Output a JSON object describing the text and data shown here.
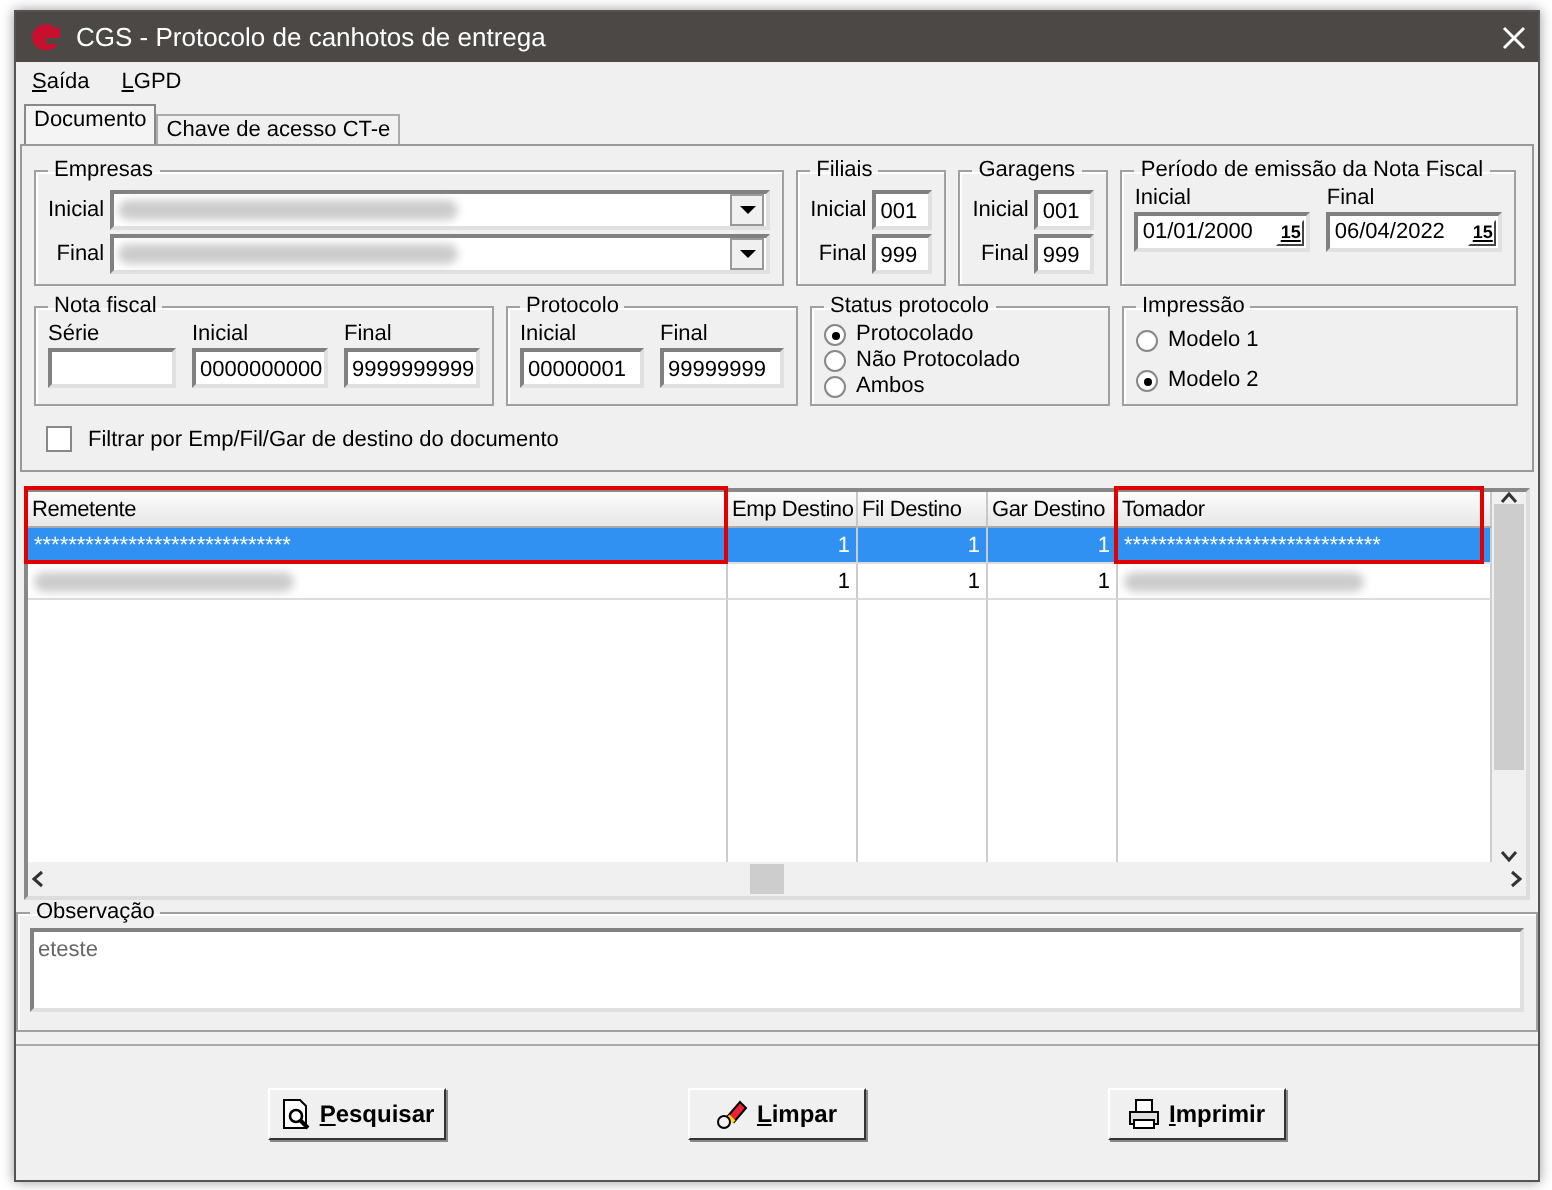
{
  "window": {
    "title": "CGS - Protocolo de canhotos de entrega"
  },
  "menu": [
    {
      "label": "Saída"
    },
    {
      "label": "LGPD"
    }
  ],
  "tabs": [
    {
      "label": "Documento",
      "selected": true
    },
    {
      "label": "Chave de acesso CT-e",
      "selected": false
    }
  ],
  "empresas": {
    "title": "Empresas",
    "fields": [
      {
        "label": "Inicial"
      },
      {
        "label": "Final"
      }
    ]
  },
  "filiais": {
    "title": "Filiais",
    "fields": [
      {
        "label": "Inicial",
        "value": "001"
      },
      {
        "label": "Final",
        "value": "999"
      }
    ]
  },
  "garagens": {
    "title": "Garagens",
    "fields": [
      {
        "label": "Inicial",
        "value": "001"
      },
      {
        "label": "Final",
        "value": "999"
      }
    ]
  },
  "periodo": {
    "title": "Período de emissão da Nota Fiscal",
    "fields": [
      {
        "label": "Inicial",
        "value": "01/01/2000",
        "button": "15"
      },
      {
        "label": "Final",
        "value": "06/04/2022",
        "button": "15"
      }
    ]
  },
  "nota_fiscal": {
    "title": "Nota fiscal",
    "fields": [
      {
        "label": "Série"
      },
      {
        "label": "Inicial",
        "value": "0000000000"
      },
      {
        "label": "Final",
        "value": "9999999999"
      }
    ]
  },
  "protocolo": {
    "title": "Protocolo",
    "fields": [
      {
        "label": "Inicial",
        "value": "00000001"
      },
      {
        "label": "Final",
        "value": "99999999"
      }
    ]
  },
  "status_protocolo": {
    "title": "Status protocolo",
    "options": [
      {
        "label": "Protocolado",
        "selected": true
      },
      {
        "label": "Não Protocolado",
        "selected": false
      },
      {
        "label": "Ambos",
        "selected": false
      }
    ]
  },
  "impressao": {
    "title": "Impressão",
    "options": [
      {
        "label": "Modelo 1",
        "selected": false
      },
      {
        "label": "Modelo 2",
        "selected": true
      }
    ]
  },
  "filter_checkbox": {
    "label": "Filtrar por Emp/Fil/Gar de destino do documento",
    "checked": false
  },
  "table": {
    "columns": [
      {
        "label": "Remetente",
        "kind": "text",
        "highlighted": true
      },
      {
        "label": "Emp Destino",
        "kind": "number",
        "highlighted": false
      },
      {
        "label": "Fil Destino",
        "kind": "number",
        "highlighted": false
      },
      {
        "label": "Gar Destino",
        "kind": "number",
        "highlighted": false
      },
      {
        "label": "Tomador",
        "kind": "text",
        "highlighted": true
      }
    ],
    "rows": [
      {
        "selected": true,
        "cells": [
          "******************************",
          "1",
          "1",
          "1",
          "******************************"
        ]
      },
      {
        "selected": false,
        "cells": [
          null,
          "1",
          "1",
          "1",
          null
        ]
      }
    ]
  },
  "observacao": {
    "title": "Observação",
    "value": "eteste"
  },
  "buttons": [
    {
      "label": "Pesquisar"
    },
    {
      "label": "Limpar"
    },
    {
      "label": "Imprimir"
    }
  ]
}
